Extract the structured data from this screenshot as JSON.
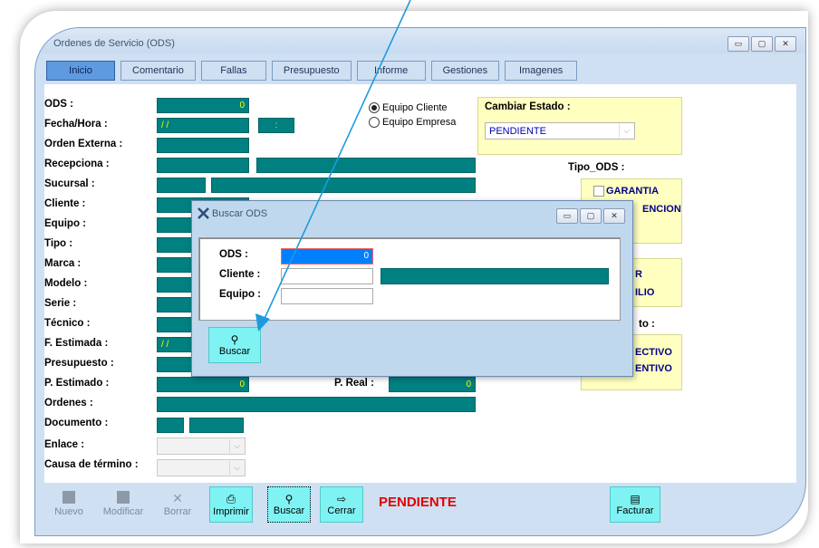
{
  "window": {
    "title": "Ordenes de Servicio (ODS)",
    "controls": [
      "▭",
      "▢",
      "✕"
    ]
  },
  "tabs": [
    "Inicio",
    "Comentario",
    "Fallas",
    "Presupuesto",
    "Informe",
    "Gestiones",
    "Imagenes"
  ],
  "labels": {
    "ods": "ODS :",
    "fecha": "Fecha/Hora :",
    "orden_externa": "Orden Externa :",
    "recepciona": "Recepciona :",
    "sucursal": "Sucursal :",
    "cliente": "Cliente :",
    "equipo": "Equipo :",
    "tipo": "Tipo :",
    "marca": "Marca :",
    "modelo": "Modelo :",
    "serie": "Serie :",
    "tecnico": "Técnico :",
    "f_estimada": "F. Estimada :",
    "presupuesto": "Presupuesto :",
    "p_estimado": "P. Estimado :",
    "p_real": "P. Real :",
    "ordenes": "Ordenes :",
    "documento": "Documento :",
    "enlace": "Enlace :",
    "causa": "Causa de término :"
  },
  "values": {
    "ods": "0",
    "fecha": "/ /",
    "hora": ":",
    "f_estimada": "/ /",
    "p_estimado": "0",
    "p_real": "0"
  },
  "equipo_radio": {
    "cliente": "Equipo Cliente",
    "empresa": "Equipo Empresa"
  },
  "estado": {
    "label": "Cambiar Estado :",
    "value": "PENDIENTE"
  },
  "tipo_ods": {
    "label": "Tipo_ODS :",
    "garantia": "GARANTIA",
    "atencion_partial": "ENCION"
  },
  "right_partial": {
    "r": "R",
    "domicilio_partial": "ILIO",
    "to": "to :",
    "correctivo_partial": "ECTIVO",
    "preventivo_partial": "ENTIVO"
  },
  "bottom": {
    "nuevo": "Nuevo",
    "modificar": "Modificar",
    "borrar": "Borrar",
    "imprimir": "Imprimir",
    "buscar": "Buscar",
    "cerrar": "Cerrar",
    "facturar": "Facturar",
    "status": "PENDIENTE"
  },
  "dialog": {
    "title": "Buscar ODS",
    "ods_label": "ODS :",
    "cliente_label": "Cliente :",
    "equipo_label": "Equipo :",
    "ods_value": "0",
    "buscar": "Buscar"
  },
  "colors": {
    "teal": "#008080",
    "cyan_button": "#7ff3f3",
    "arrow": "#1e9be0",
    "status_red": "#e00000"
  }
}
